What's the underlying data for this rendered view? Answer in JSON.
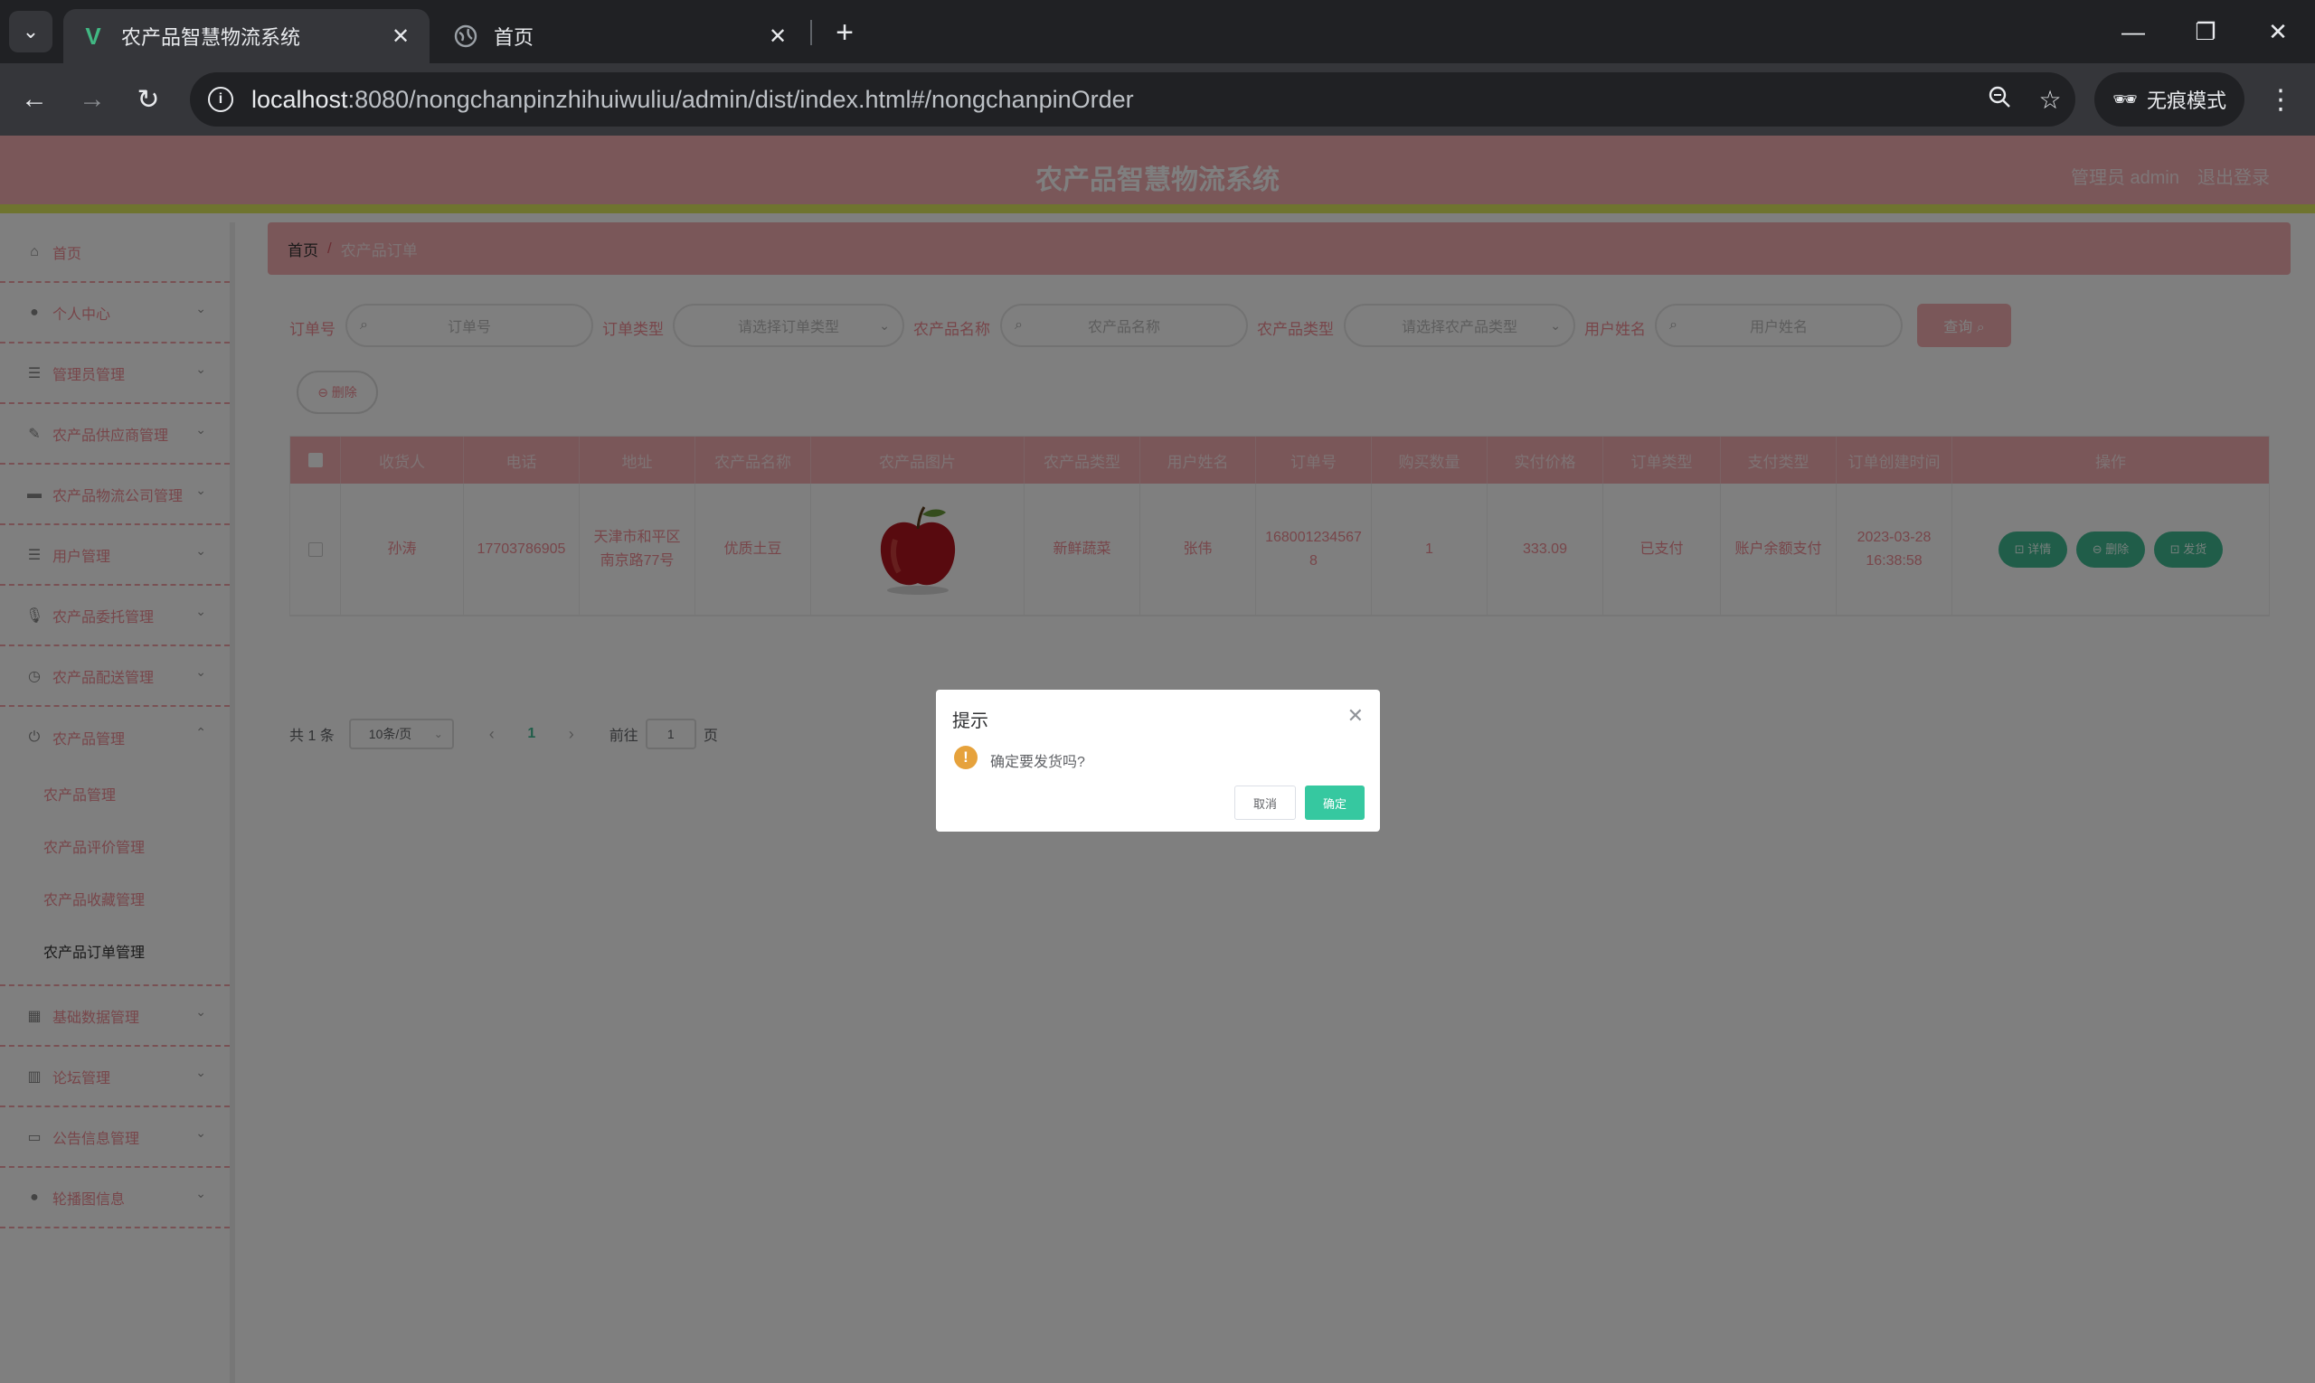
{
  "browser": {
    "tabs": [
      {
        "title": "农产品智慧物流系统",
        "favicon": "vue-logo-icon",
        "active": true
      },
      {
        "title": "首页",
        "favicon": "globe-icon",
        "active": false
      }
    ],
    "url_host": "localhost",
    "url_rest": ":8080/nongchanpinzhihuiwuliu/admin/dist/index.html#/nongchanpinOrder",
    "incognito_label": "无痕模式"
  },
  "app": {
    "title": "农产品智慧物流系统",
    "user": "管理员 admin",
    "logout": "退出登录"
  },
  "sidebar": {
    "items": [
      {
        "label": "首页",
        "icon": "home-icon",
        "arrow": ""
      },
      {
        "label": "个人中心",
        "icon": "user-icon",
        "arrow": "⌄"
      },
      {
        "label": "管理员管理",
        "icon": "list-icon",
        "arrow": "⌄"
      },
      {
        "label": "农产品供应商管理",
        "icon": "pen-icon",
        "arrow": "⌄"
      },
      {
        "label": "农产品物流公司管理",
        "icon": "truck-icon",
        "arrow": "⌄"
      },
      {
        "label": "用户管理",
        "icon": "list-icon",
        "arrow": "⌄"
      },
      {
        "label": "农产品委托管理",
        "icon": "mic-icon",
        "arrow": "⌄"
      },
      {
        "label": "农产品配送管理",
        "icon": "clock-icon",
        "arrow": "⌄"
      },
      {
        "label": "农产品管理",
        "icon": "power-icon",
        "arrow": "⌃"
      }
    ],
    "subitems": [
      "农产品管理",
      "农产品评价管理",
      "农产品收藏管理",
      "农产品订单管理"
    ],
    "items_after": [
      {
        "label": "基础数据管理",
        "icon": "grid-icon",
        "arrow": "⌄"
      },
      {
        "label": "论坛管理",
        "icon": "bar-chart-icon",
        "arrow": "⌄"
      },
      {
        "label": "公告信息管理",
        "icon": "card-icon",
        "arrow": "⌄"
      },
      {
        "label": "轮播图信息",
        "icon": "user-icon",
        "arrow": "⌄"
      }
    ]
  },
  "breadcrumb": {
    "home": "首页",
    "sep": "/",
    "current": "农产品订单"
  },
  "filters": {
    "order_no_label": "订单号",
    "order_no_placeholder": "订单号",
    "order_type_label": "订单类型",
    "order_type_placeholder": "请选择订单类型",
    "product_name_label": "农产品名称",
    "product_name_placeholder": "农产品名称",
    "product_type_label": "农产品类型",
    "product_type_placeholder": "请选择农产品类型",
    "user_name_label": "用户姓名",
    "user_name_placeholder": "用户姓名",
    "search_button": "查询 ⌕"
  },
  "delete_button": "⊖ 删除",
  "table": {
    "headers": [
      "收货人",
      "电话",
      "地址",
      "农产品名称",
      "农产品图片",
      "农产品类型",
      "用户姓名",
      "订单号",
      "购买数量",
      "实付价格",
      "订单类型",
      "支付类型",
      "订单创建时间",
      "操作"
    ],
    "rows": [
      {
        "receiver": "孙涛",
        "phone": "17703786905",
        "address": "天津市和平区南京路77号",
        "product_name": "优质土豆",
        "product_type": "新鲜蔬菜",
        "user_name": "张伟",
        "order_no": "1680012345678",
        "quantity": "1",
        "price": "333.09",
        "order_type": "已支付",
        "pay_type": "账户余额支付",
        "created_time": "2023-03-28 16:38:58",
        "btn_detail": "⊡ 详情",
        "btn_delete": "⊖ 删除",
        "btn_ship": "⊡ 发货"
      }
    ]
  },
  "pagination": {
    "total": "共 1 条",
    "page_size": "10条/页",
    "prev": "‹",
    "page": "1",
    "next": "›",
    "goto_prefix": "前往",
    "goto_value": "1",
    "goto_suffix": "页"
  },
  "dialog": {
    "title": "提示",
    "message": "确定要发货吗?",
    "cancel": "取消",
    "confirm": "确定"
  },
  "colors": {
    "header_pink": "#f4aeb3",
    "accent_yellow": "#dfe95f",
    "action_green": "#41bb93",
    "confirm_green": "#36c8a0",
    "warning_orange": "#e6a23c"
  }
}
